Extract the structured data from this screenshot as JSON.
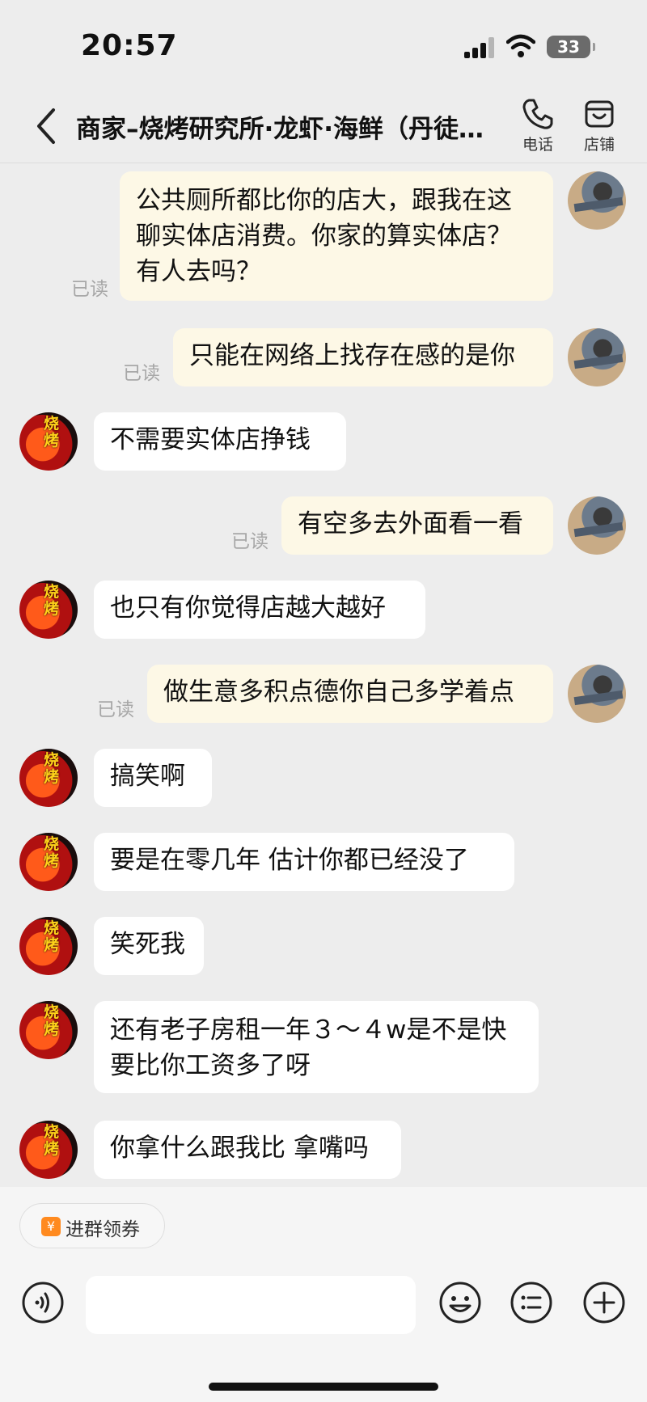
{
  "status_bar": {
    "time": "20:57",
    "battery": "33"
  },
  "header": {
    "back_icon": "chevron-left-icon",
    "title": "商家–烧烤研究所·龙虾·海鲜（丹徒…",
    "actions": [
      {
        "icon": "phone-icon",
        "label": "电话"
      },
      {
        "icon": "store-icon",
        "label": "店铺"
      }
    ]
  },
  "messages": [
    {
      "side": "out",
      "text": "公共厕所都比你的店大，跟我在这\n聊实体店消费。你家的算实体店？\n有人去吗？",
      "read": "已读"
    },
    {
      "side": "out",
      "text": "只能在网络上找存在感的是你",
      "read": "已读"
    },
    {
      "side": "in",
      "text": "不需要实体店挣钱"
    },
    {
      "side": "out",
      "text": "有空多去外面看一看",
      "read": "已读"
    },
    {
      "side": "in",
      "text": "也只有你觉得店越大越好"
    },
    {
      "side": "out",
      "text": "做生意多积点德你自己多学着点",
      "read": "已读"
    },
    {
      "side": "in",
      "text": "搞笑啊"
    },
    {
      "side": "in",
      "text": "要是在零几年 估计你都已经没了"
    },
    {
      "side": "in",
      "text": "笑死我"
    },
    {
      "side": "in",
      "text": "还有老子房租一年３～４w是不是快\n要比你工资多了呀"
    },
    {
      "side": "in",
      "text": "你拿什么跟我比 拿嘴吗"
    }
  ],
  "shop_avatar_text": "烧烤",
  "bottom_bar": {
    "coupon": {
      "icon": "coupon-icon",
      "label": "进群领券"
    },
    "input_placeholder": "",
    "buttons": [
      "voice-icon",
      "emoji-icon",
      "list-icon",
      "plus-icon"
    ]
  },
  "colors": {
    "outgoing_bubble": "#fdf8e6",
    "incoming_bubble": "#ffffff",
    "background": "#ededed",
    "coupon_accent": "#ff8a1f"
  }
}
